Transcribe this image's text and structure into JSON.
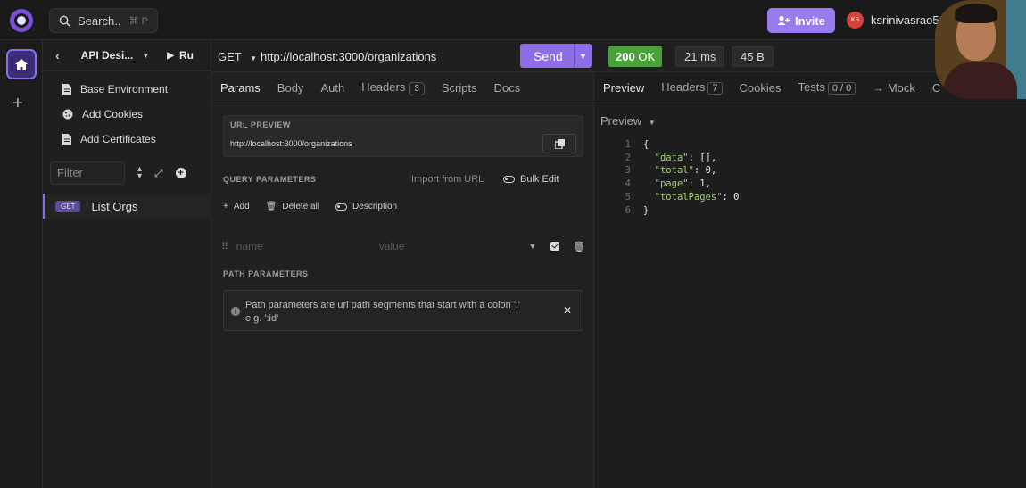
{
  "topbar": {
    "search_label": "Search..",
    "search_shortcut": "⌘ P",
    "invite_label": "Invite",
    "user_initials": "KS",
    "user_name": "ksrinivasrao53"
  },
  "sidebar": {
    "project_name": "API Desi...",
    "run_label": "Ru",
    "items": [
      {
        "label": "Base Environment",
        "icon": "doc-icon"
      },
      {
        "label": "Add Cookies",
        "icon": "cookie-icon"
      },
      {
        "label": "Add Certificates",
        "icon": "certificate-icon"
      }
    ],
    "filter_placeholder": "Filter",
    "requests": [
      {
        "method": "GET",
        "name": "List Orgs"
      }
    ]
  },
  "request": {
    "method": "GET",
    "url": "http://localhost:3000/organizations",
    "send_label": "Send",
    "tabs": [
      {
        "label": "Params",
        "active": true
      },
      {
        "label": "Body"
      },
      {
        "label": "Auth"
      },
      {
        "label": "Headers",
        "count": "3"
      },
      {
        "label": "Scripts"
      },
      {
        "label": "Docs"
      }
    ],
    "url_preview_title": "URL PREVIEW",
    "url_preview": "http://localhost:3000/organizations",
    "query_title": "QUERY PARAMETERS",
    "import_label": "Import from URL",
    "bulk_label": "Bulk Edit",
    "add_label": "Add",
    "delete_all_label": "Delete all",
    "description_label": "Description",
    "param_name_placeholder": "name",
    "param_value_placeholder": "value",
    "path_title": "PATH PARAMETERS",
    "path_info_line1": "Path parameters are url path segments that start with a colon ':'",
    "path_info_line2": "e.g. ':id'"
  },
  "response": {
    "status_code": "200",
    "status_text": "OK",
    "time": "21 ms",
    "size": "45 B",
    "tabs": [
      {
        "label": "Preview",
        "active": true
      },
      {
        "label": "Headers",
        "count": "7"
      },
      {
        "label": "Cookies"
      },
      {
        "label": "Tests",
        "count": "0 / 0"
      },
      {
        "label": "→ Mock"
      },
      {
        "label": "C"
      }
    ],
    "preview_mode": "Preview",
    "code_lines": [
      {
        "n": "1",
        "t": "{"
      },
      {
        "n": "2",
        "t": "  \"data\": [],"
      },
      {
        "n": "3",
        "t": "  \"total\": 0,"
      },
      {
        "n": "4",
        "t": "  \"page\": 1,"
      },
      {
        "n": "5",
        "t": "  \"totalPages\": 0"
      },
      {
        "n": "6",
        "t": "}"
      }
    ]
  },
  "colors": {
    "accent": "#8d6ee6",
    "status_ok": "#4aa13a",
    "json_key": "#9ed36a"
  }
}
